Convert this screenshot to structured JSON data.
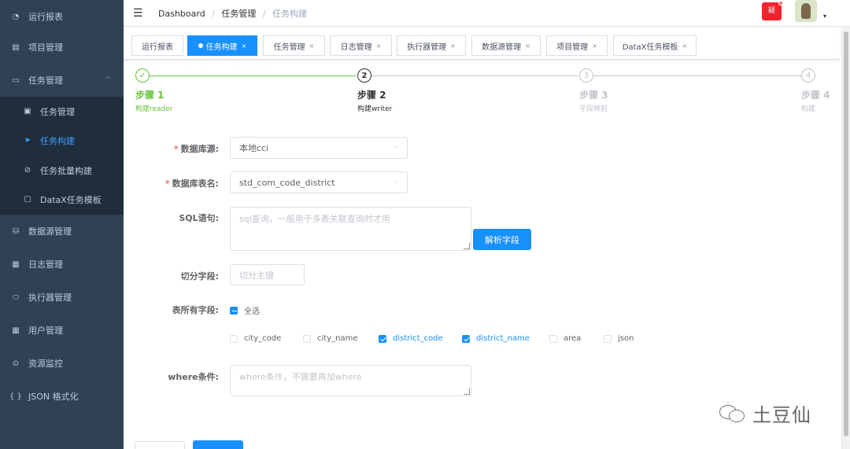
{
  "sidebar": {
    "items": [
      {
        "label": "运行报表",
        "icon": "dashboard-icon",
        "glyph": "◔"
      },
      {
        "label": "项目管理",
        "icon": "project-icon",
        "glyph": "▤"
      },
      {
        "label": "任务管理",
        "icon": "task-icon",
        "glyph": "▭"
      },
      {
        "label": "数据源管理",
        "icon": "datasource-icon",
        "glyph": "⛁"
      },
      {
        "label": "日志管理",
        "icon": "log-icon",
        "glyph": "▦"
      },
      {
        "label": "执行器管理",
        "icon": "executor-icon",
        "glyph": "⬭"
      },
      {
        "label": "用户管理",
        "icon": "user-table-icon",
        "glyph": "▦"
      },
      {
        "label": "资源监控",
        "icon": "monitor-icon",
        "glyph": "⊙"
      },
      {
        "label": "JSON 格式化",
        "icon": "json-icon",
        "glyph": "{ }"
      }
    ],
    "submenu": [
      {
        "label": "任务管理",
        "icon": "task-list-icon",
        "glyph": "▣"
      },
      {
        "label": "任务构建",
        "icon": "send-icon",
        "glyph": "➤"
      },
      {
        "label": "任务批量构建",
        "icon": "batch-icon",
        "glyph": "⊘"
      },
      {
        "label": "DataX任务模板",
        "icon": "template-icon",
        "glyph": "▢"
      }
    ],
    "expanded_chevron": "^"
  },
  "navbar": {
    "hamburger": "☰",
    "breadcrumb": [
      "Dashboard",
      "任务管理",
      "任务构建"
    ],
    "separator": "/",
    "notify_label": "疑",
    "caret": "▾"
  },
  "tags": [
    {
      "label": "运行报表",
      "closable": false
    },
    {
      "label": "任务构建",
      "closable": true,
      "active": true
    },
    {
      "label": "任务管理",
      "closable": true
    },
    {
      "label": "日志管理",
      "closable": true
    },
    {
      "label": "执行器管理",
      "closable": true
    },
    {
      "label": "数据源管理",
      "closable": true
    },
    {
      "label": "项目管理",
      "closable": true
    },
    {
      "label": "DataX任务模板",
      "closable": true
    }
  ],
  "close_glyph": "×",
  "steps": [
    {
      "icon": "✓",
      "title": "步骤 1",
      "desc": "构建reader",
      "status": "done"
    },
    {
      "icon": "2",
      "title": "步骤 2",
      "desc": "构建writer",
      "status": "process"
    },
    {
      "icon": "3",
      "title": "步骤 3",
      "desc": "字段映射",
      "status": "wait"
    },
    {
      "icon": "4",
      "title": "步骤 4",
      "desc": "构建",
      "status": "wait"
    }
  ],
  "form": {
    "datasource": {
      "label": "数据库源:",
      "value": "本地cci",
      "required": true
    },
    "table": {
      "label": "数据库表名:",
      "value": "std_com_code_district",
      "required": true
    },
    "sql": {
      "label": "SQL语句:",
      "placeholder": "sql查询，一般用于多表关联查询时才用"
    },
    "parse_button": "解析字段",
    "split": {
      "label": "切分字段:",
      "placeholder": "切分主键"
    },
    "fields": {
      "label": "表所有字段:",
      "select_all": "全选",
      "options": [
        {
          "name": "city_code",
          "checked": false
        },
        {
          "name": "city_name",
          "checked": false
        },
        {
          "name": "district_code",
          "checked": true
        },
        {
          "name": "district_name",
          "checked": true
        },
        {
          "name": "area",
          "checked": false
        },
        {
          "name": "json",
          "checked": false
        }
      ]
    },
    "where": {
      "label": "where条件:",
      "placeholder": "where条件，不需要再加where"
    },
    "select_arrow": "⌵"
  },
  "watermark": {
    "text": "土豆仙"
  }
}
